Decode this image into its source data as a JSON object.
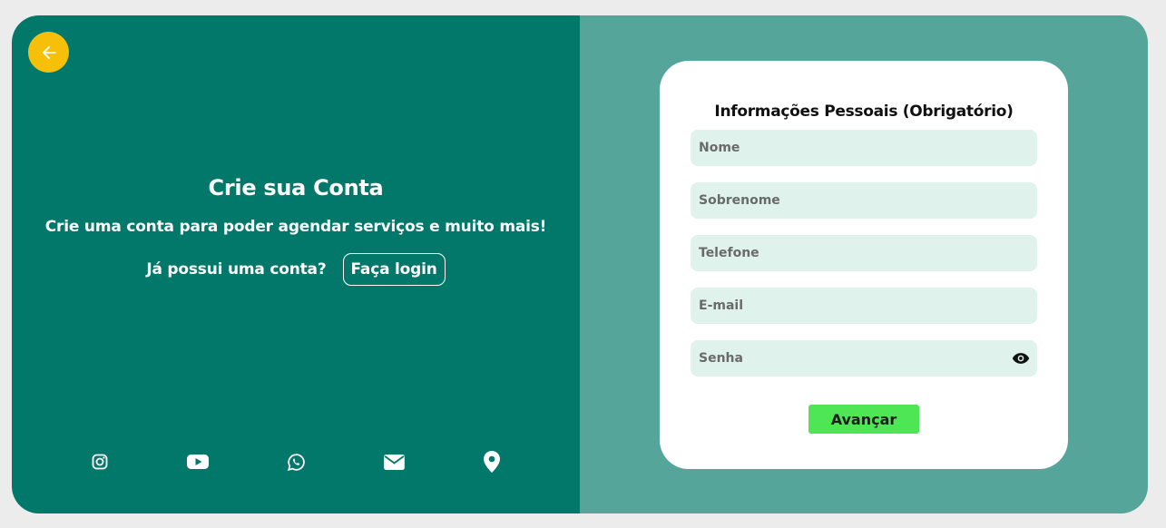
{
  "left_panel": {
    "headline": "Crie sua Conta",
    "subtitle": "Crie uma conta para poder agendar serviços e muito mais!",
    "login_question": "Já possui uma conta?",
    "login_button": "Faça login",
    "back_icon": "arrow-left-icon",
    "socials": [
      "instagram-icon",
      "youtube-icon",
      "whatsapp-icon",
      "email-icon",
      "location-pin-icon"
    ]
  },
  "form": {
    "title": "Informações Pessoais (Obrigatório)",
    "fields": {
      "first_name": {
        "placeholder": "Nome",
        "value": ""
      },
      "last_name": {
        "placeholder": "Sobrenome",
        "value": ""
      },
      "phone": {
        "placeholder": "Telefone",
        "value": ""
      },
      "email": {
        "placeholder": "E-mail",
        "value": ""
      },
      "password": {
        "placeholder": "Senha",
        "value": ""
      }
    },
    "submit_label": "Avançar",
    "password_toggle_icon": "eye-icon"
  },
  "colors": {
    "left_bg": "#02786a",
    "right_bg": "#56a59a",
    "accent_yellow": "#f6bf0a",
    "field_bg": "#dff3ec",
    "submit_bg": "#4ee655"
  }
}
